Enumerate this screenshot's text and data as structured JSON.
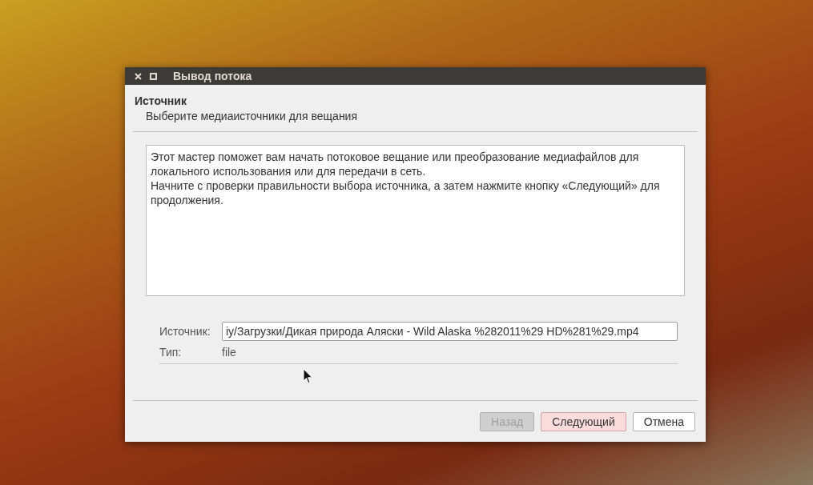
{
  "window": {
    "title": "Вывод потока"
  },
  "header": {
    "title": "Источник",
    "subtitle": "Выберите медиаисточники для вещания"
  },
  "description": [
    "Этот мастер поможет вам начать потоковое вещание или преобразование медиафайлов для локального использования или для передачи в сеть.",
    "Начните с проверки правильности выбора источника, а затем нажмите кнопку «Следующий» для продолжения."
  ],
  "fields": [
    {
      "kind": "input",
      "label": "Источник:",
      "value": "iy/Загрузки/Дикая природа Аляски - Wild Alaska %282011%29 HD%281%29.mp4"
    },
    {
      "kind": "text",
      "label": "Тип:",
      "value": "file"
    }
  ],
  "buttons": [
    {
      "label": "Назад",
      "disabled": true,
      "default": false
    },
    {
      "label": "Следующий",
      "disabled": false,
      "default": true
    },
    {
      "label": "Отмена",
      "disabled": false,
      "default": false
    }
  ]
}
